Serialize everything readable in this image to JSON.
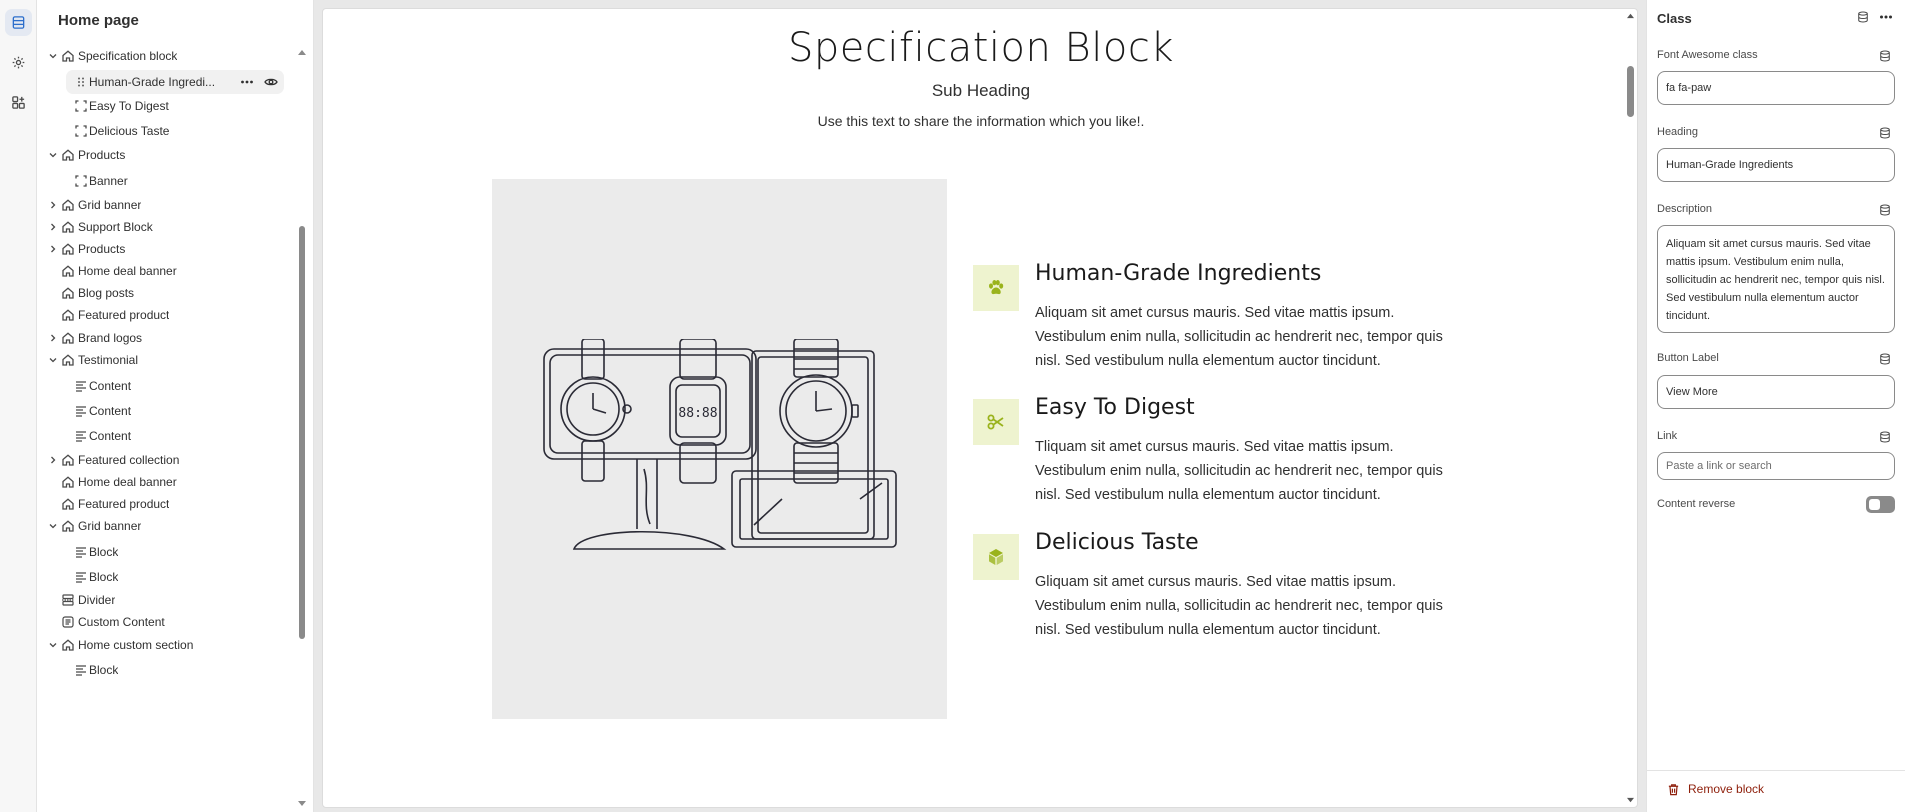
{
  "colors": {
    "accent": "#2c6ecb",
    "icon_bg": "#eef3cf",
    "icon_fg": "#9ab31c",
    "danger": "#8e1f0b"
  },
  "rail": {
    "items": [
      "sections-icon",
      "settings-gear-icon",
      "apps-icon"
    ]
  },
  "sidebar": {
    "title": "Home page",
    "items": [
      {
        "label": "Specification block",
        "icon": "section-home-icon",
        "expand": "open"
      },
      {
        "label": "Human-Grade Ingredi...",
        "icon": "drag-handle-icon",
        "selected": true
      },
      {
        "label": "Easy To Digest",
        "icon": "block-dashed-icon"
      },
      {
        "label": "Delicious Taste",
        "icon": "block-dashed-icon"
      },
      {
        "label": "Products",
        "icon": "section-home-icon",
        "expand": "open"
      },
      {
        "label": "Banner",
        "icon": "block-dashed-icon"
      },
      {
        "label": "Grid banner",
        "icon": "section-home-icon",
        "expand": "closed"
      },
      {
        "label": "Support Block",
        "icon": "section-home-icon",
        "expand": "closed"
      },
      {
        "label": "Products",
        "icon": "section-home-icon",
        "expand": "closed"
      },
      {
        "label": "Home deal banner",
        "icon": "section-home-icon"
      },
      {
        "label": "Blog posts",
        "icon": "section-home-icon"
      },
      {
        "label": "Featured product",
        "icon": "section-home-icon"
      },
      {
        "label": "Brand logos",
        "icon": "section-home-icon",
        "expand": "closed"
      },
      {
        "label": "Testimonial",
        "icon": "section-home-icon",
        "expand": "open"
      },
      {
        "label": "Content",
        "icon": "text-lines-icon"
      },
      {
        "label": "Content",
        "icon": "text-lines-icon"
      },
      {
        "label": "Content",
        "icon": "text-lines-icon"
      },
      {
        "label": "Featured collection",
        "icon": "section-home-icon",
        "expand": "closed"
      },
      {
        "label": "Home deal banner",
        "icon": "section-home-icon"
      },
      {
        "label": "Featured product",
        "icon": "section-home-icon"
      },
      {
        "label": "Grid banner",
        "icon": "section-home-icon",
        "expand": "open"
      },
      {
        "label": "Block",
        "icon": "text-lines-icon"
      },
      {
        "label": "Block",
        "icon": "text-lines-icon"
      },
      {
        "label": "Divider",
        "icon": "divider-icon"
      },
      {
        "label": "Custom Content",
        "icon": "custom-content-icon"
      },
      {
        "label": "Home custom section",
        "icon": "section-home-icon",
        "expand": "open"
      },
      {
        "label": "Block",
        "icon": "text-lines-icon"
      }
    ]
  },
  "canvas": {
    "title": "Specification Block",
    "subheading": "Sub Heading",
    "description": "Use this text to share the information which you like!.",
    "features": [
      {
        "icon": "paw-icon",
        "title": "Human-Grade Ingredients",
        "text": "Aliquam sit amet cursus mauris. Sed vitae mattis ipsum. Vestibulum enim nulla, sollicitudin ac hendrerit nec, tempor quis nisl. Sed vestibulum nulla elementum auctor tincidunt."
      },
      {
        "icon": "scissors-icon",
        "title": "Easy To Digest",
        "text": "Tliquam sit amet cursus mauris. Sed vitae mattis ipsum. Vestibulum enim nulla, sollicitudin ac hendrerit nec, tempor quis nisl. Sed vestibulum nulla elementum auctor tincidunt."
      },
      {
        "icon": "cube-icon",
        "title": "Delicious Taste",
        "text": "Gliquam sit amet cursus mauris. Sed vitae mattis ipsum. Vestibulum enim nulla, sollicitudin ac hendrerit nec, tempor quis nisl. Sed vestibulum nulla elementum auctor tincidunt."
      }
    ],
    "watch_display": "88:88"
  },
  "panel": {
    "title": "Class",
    "fields": {
      "fa_class": {
        "label": "Font Awesome class",
        "value": "fa fa-paw"
      },
      "heading": {
        "label": "Heading",
        "value": "Human-Grade Ingredients"
      },
      "description": {
        "label": "Description",
        "value": "Aliquam sit amet cursus mauris. Sed vitae mattis ipsum. Vestibulum enim nulla, sollicitudin ac hendrerit nec, tempor quis nisl. Sed vestibulum nulla elementum auctor tincidunt."
      },
      "button_label": {
        "label": "Button Label",
        "value": "View More"
      },
      "link": {
        "label": "Link",
        "placeholder": "Paste a link or search"
      },
      "content_reverse": {
        "label": "Content reverse",
        "enabled": false
      }
    },
    "remove_label": "Remove block"
  }
}
